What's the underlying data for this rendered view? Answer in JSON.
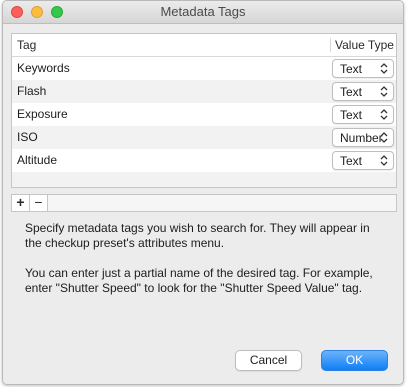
{
  "window": {
    "title": "Metadata Tags"
  },
  "table": {
    "headers": {
      "tag": "Tag",
      "value_type": "Value Type"
    },
    "rows": [
      {
        "tag": "Keywords",
        "value_type": "Text"
      },
      {
        "tag": "Flash",
        "value_type": "Text"
      },
      {
        "tag": "Exposure",
        "value_type": "Text"
      },
      {
        "tag": "ISO",
        "value_type": "Number"
      },
      {
        "tag": "Altitude",
        "value_type": "Text"
      }
    ]
  },
  "controls": {
    "add_label": "+",
    "remove_label": "−"
  },
  "help": {
    "paragraph1": "Specify metadata tags you wish to search for. They will appear in the checkup preset's attributes menu.",
    "paragraph2": "You can enter just a partial name of the desired tag. For example, enter \"Shutter Speed\" to look for the \"Shutter Speed Value\" tag."
  },
  "buttons": {
    "cancel": "Cancel",
    "ok": "OK"
  },
  "colors": {
    "close": "#fc605c",
    "minimize": "#fdbc40",
    "maximize": "#34c84a",
    "accent": "#0e7ef6"
  },
  "icons": {
    "popup_chevron": "chevron-up-down-icon"
  }
}
